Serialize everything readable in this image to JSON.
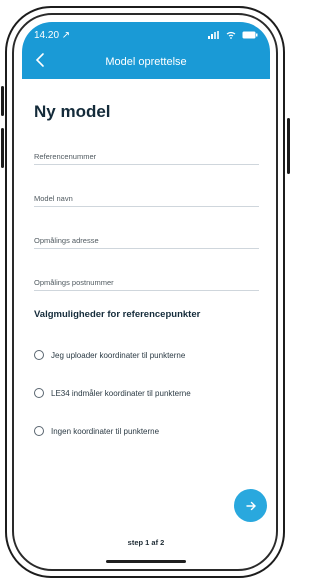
{
  "status_bar": {
    "time": "14.20 ↗"
  },
  "nav": {
    "title": "Model oprettelse"
  },
  "page": {
    "title": "Ny model"
  },
  "fields": {
    "ref_label": "Referencenummer",
    "model_label": "Model navn",
    "addr_label": "Opmålings adresse",
    "zip_label": "Opmålings postnummer"
  },
  "options": {
    "section_title": "Valgmuligheder for referencepunkter",
    "items": [
      {
        "label": "Jeg uploader koordinater til punkterne"
      },
      {
        "label": "LE34 indmåler koordinater til punkterne"
      },
      {
        "label": "Ingen koordinater til punkterne"
      }
    ]
  },
  "footer": {
    "step": "step 1 af 2"
  },
  "colors": {
    "header": "#1a9ad6",
    "fab": "#29a8de"
  },
  "icons": {
    "back": "chevron-left-icon",
    "next": "arrow-right-icon"
  }
}
